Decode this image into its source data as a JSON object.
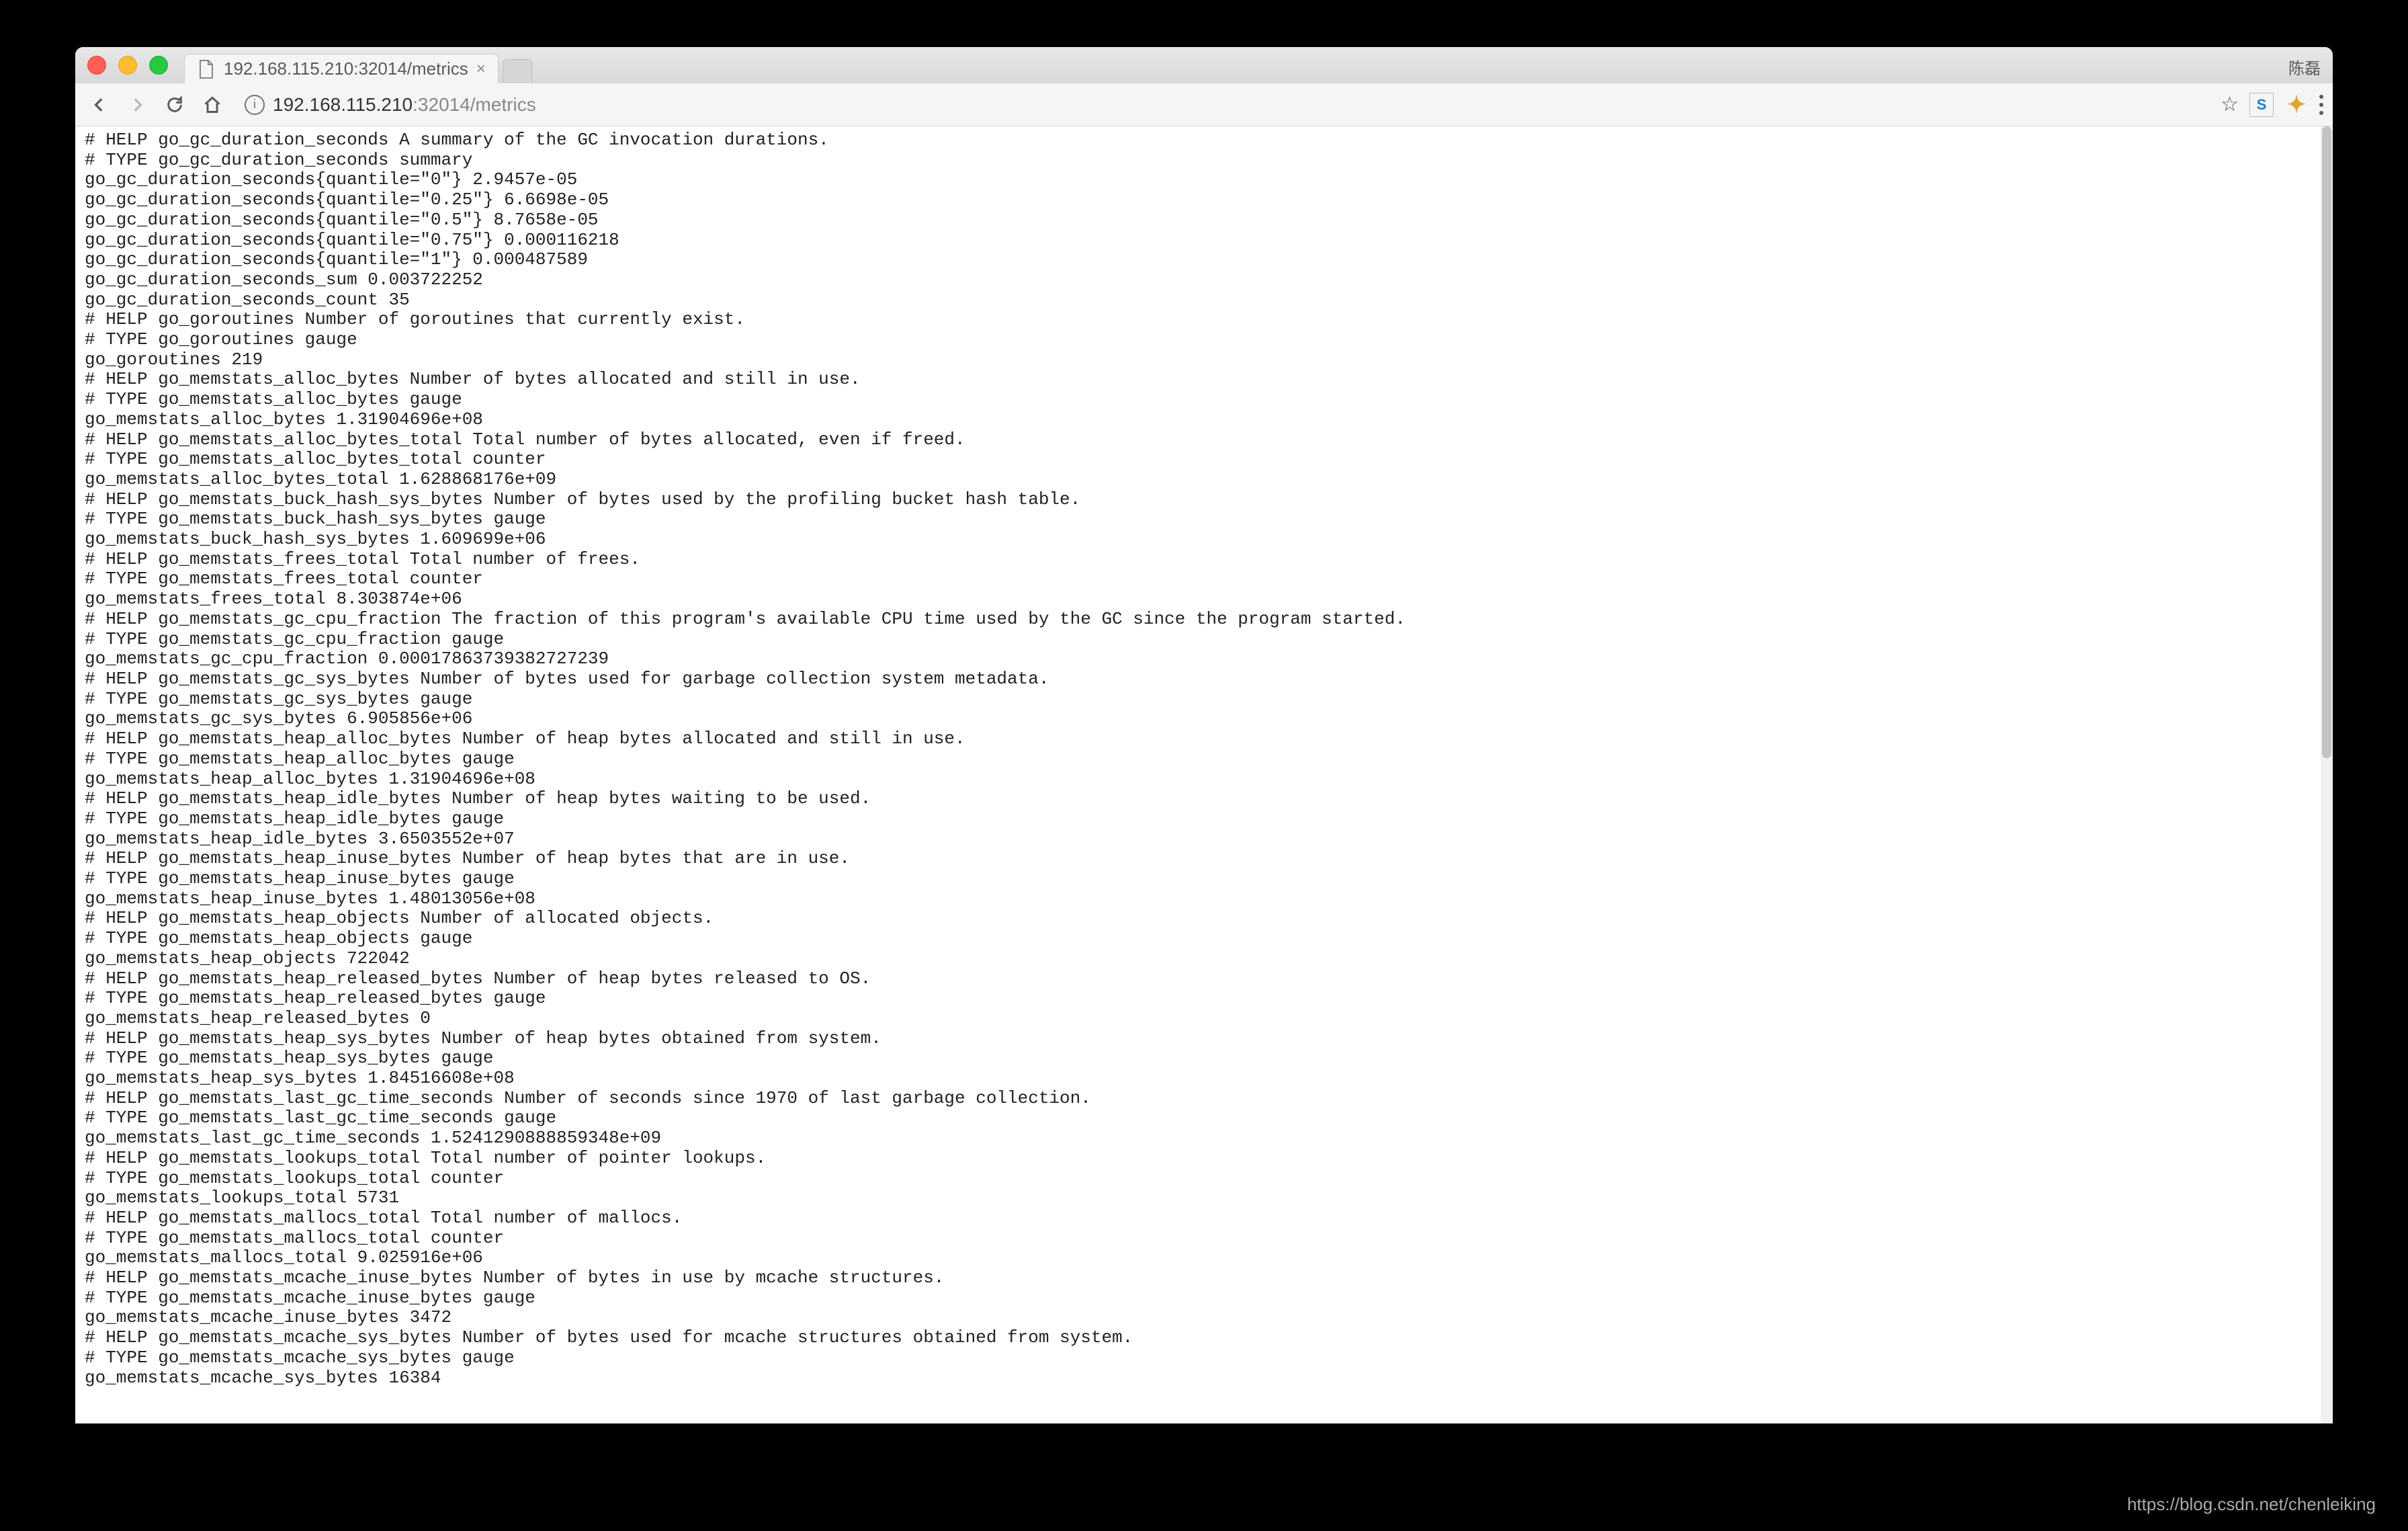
{
  "browser": {
    "tab_title": "192.168.115.210:32014/metrics",
    "user_label": "陈磊",
    "url_host": "192.168.115.210",
    "url_port_path": ":32014/metrics"
  },
  "metrics_lines": [
    "# HELP go_gc_duration_seconds A summary of the GC invocation durations.",
    "# TYPE go_gc_duration_seconds summary",
    "go_gc_duration_seconds{quantile=\"0\"} 2.9457e-05",
    "go_gc_duration_seconds{quantile=\"0.25\"} 6.6698e-05",
    "go_gc_duration_seconds{quantile=\"0.5\"} 8.7658e-05",
    "go_gc_duration_seconds{quantile=\"0.75\"} 0.000116218",
    "go_gc_duration_seconds{quantile=\"1\"} 0.000487589",
    "go_gc_duration_seconds_sum 0.003722252",
    "go_gc_duration_seconds_count 35",
    "# HELP go_goroutines Number of goroutines that currently exist.",
    "# TYPE go_goroutines gauge",
    "go_goroutines 219",
    "# HELP go_memstats_alloc_bytes Number of bytes allocated and still in use.",
    "# TYPE go_memstats_alloc_bytes gauge",
    "go_memstats_alloc_bytes 1.31904696e+08",
    "# HELP go_memstats_alloc_bytes_total Total number of bytes allocated, even if freed.",
    "# TYPE go_memstats_alloc_bytes_total counter",
    "go_memstats_alloc_bytes_total 1.628868176e+09",
    "# HELP go_memstats_buck_hash_sys_bytes Number of bytes used by the profiling bucket hash table.",
    "# TYPE go_memstats_buck_hash_sys_bytes gauge",
    "go_memstats_buck_hash_sys_bytes 1.609699e+06",
    "# HELP go_memstats_frees_total Total number of frees.",
    "# TYPE go_memstats_frees_total counter",
    "go_memstats_frees_total 8.303874e+06",
    "# HELP go_memstats_gc_cpu_fraction The fraction of this program's available CPU time used by the GC since the program started.",
    "# TYPE go_memstats_gc_cpu_fraction gauge",
    "go_memstats_gc_cpu_fraction 0.00017863739382727239",
    "# HELP go_memstats_gc_sys_bytes Number of bytes used for garbage collection system metadata.",
    "# TYPE go_memstats_gc_sys_bytes gauge",
    "go_memstats_gc_sys_bytes 6.905856e+06",
    "# HELP go_memstats_heap_alloc_bytes Number of heap bytes allocated and still in use.",
    "# TYPE go_memstats_heap_alloc_bytes gauge",
    "go_memstats_heap_alloc_bytes 1.31904696e+08",
    "# HELP go_memstats_heap_idle_bytes Number of heap bytes waiting to be used.",
    "# TYPE go_memstats_heap_idle_bytes gauge",
    "go_memstats_heap_idle_bytes 3.6503552e+07",
    "# HELP go_memstats_heap_inuse_bytes Number of heap bytes that are in use.",
    "# TYPE go_memstats_heap_inuse_bytes gauge",
    "go_memstats_heap_inuse_bytes 1.48013056e+08",
    "# HELP go_memstats_heap_objects Number of allocated objects.",
    "# TYPE go_memstats_heap_objects gauge",
    "go_memstats_heap_objects 722042",
    "# HELP go_memstats_heap_released_bytes Number of heap bytes released to OS.",
    "# TYPE go_memstats_heap_released_bytes gauge",
    "go_memstats_heap_released_bytes 0",
    "# HELP go_memstats_heap_sys_bytes Number of heap bytes obtained from system.",
    "# TYPE go_memstats_heap_sys_bytes gauge",
    "go_memstats_heap_sys_bytes 1.84516608e+08",
    "# HELP go_memstats_last_gc_time_seconds Number of seconds since 1970 of last garbage collection.",
    "# TYPE go_memstats_last_gc_time_seconds gauge",
    "go_memstats_last_gc_time_seconds 1.5241290888859348e+09",
    "# HELP go_memstats_lookups_total Total number of pointer lookups.",
    "# TYPE go_memstats_lookups_total counter",
    "go_memstats_lookups_total 5731",
    "# HELP go_memstats_mallocs_total Total number of mallocs.",
    "# TYPE go_memstats_mallocs_total counter",
    "go_memstats_mallocs_total 9.025916e+06",
    "# HELP go_memstats_mcache_inuse_bytes Number of bytes in use by mcache structures.",
    "# TYPE go_memstats_mcache_inuse_bytes gauge",
    "go_memstats_mcache_inuse_bytes 3472",
    "# HELP go_memstats_mcache_sys_bytes Number of bytes used for mcache structures obtained from system.",
    "# TYPE go_memstats_mcache_sys_bytes gauge",
    "go_memstats_mcache_sys_bytes 16384"
  ],
  "watermark": "https://blog.csdn.net/chenleiking"
}
